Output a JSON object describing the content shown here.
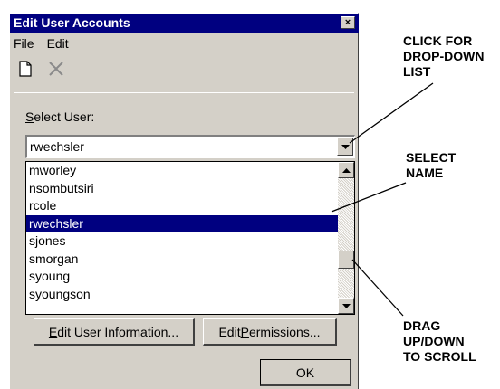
{
  "window": {
    "title": "Edit User Accounts",
    "close_glyph": "×"
  },
  "menu": {
    "file": "File",
    "edit": "Edit"
  },
  "toolbar": {
    "new_icon": "new-document-icon",
    "delete_icon": "delete-x-icon"
  },
  "select_user": {
    "label_first": "S",
    "label_rest": "elect User:",
    "value": "rwechsler"
  },
  "user_list": {
    "items": [
      "mworley",
      "nsombutsiri",
      "rcole",
      "rwechsler",
      "sjones",
      "smorgan",
      "syoung",
      "syoungson"
    ],
    "selected": "rwechsler"
  },
  "buttons": {
    "edit_info_first": "E",
    "edit_info_rest": "dit User Information...",
    "edit_perm_first": "Edit ",
    "edit_perm_u": "P",
    "edit_perm_rest": "ermissions...",
    "ok": "OK"
  },
  "annotations": {
    "dropdown": [
      "CLICK FOR",
      "DROP-DOWN",
      "LIST"
    ],
    "select": [
      "SELECT",
      "NAME"
    ],
    "drag": [
      "DRAG",
      "UP/DOWN",
      "TO SCROLL"
    ]
  },
  "colors": {
    "title_bar": "#000080",
    "selection": "#000080",
    "face": "#d4d0c8"
  }
}
